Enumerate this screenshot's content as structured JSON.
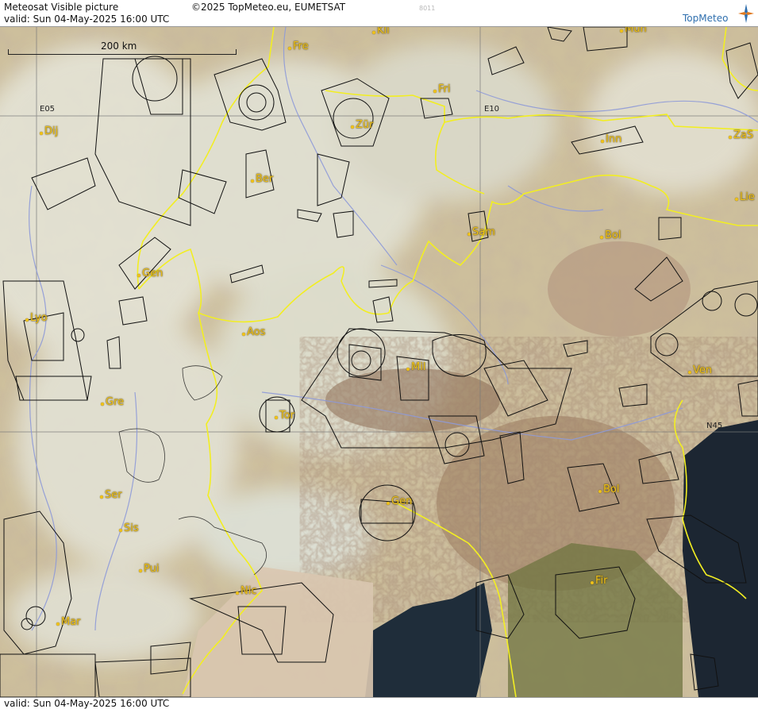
{
  "header": {
    "title": "Meteosat Visible picture",
    "copyright": "©2025 TopMeteo.eu, EUMETSAT",
    "code": "8011",
    "valid": "valid:  Sun  04-May-2025  16:00 UTC",
    "logo_text": "TopMeteo"
  },
  "footer": {
    "valid": "valid:  Sun  04-May-2025  16:00 UTC"
  },
  "scale": {
    "label": "200 km"
  },
  "grid_labels": {
    "e05": "E05",
    "e10": "E10",
    "n45": "N45"
  },
  "cities": [
    "Kli",
    "Mün",
    "Fre",
    "Fri",
    "Dij",
    "Zür",
    "Inn",
    "ZaS",
    "Ber",
    "Lie",
    "Sam",
    "Bol",
    "Gen",
    "Lyo",
    "Aos",
    "Ven",
    "Mil",
    "Gre",
    "Tor",
    "Ser",
    "Gen",
    "Bol",
    "Sis",
    "Pui",
    "Nic",
    "Fir",
    "Mar"
  ],
  "colors": {
    "land": "#cdbf9c",
    "cloud": "#e2e2d6",
    "sea": "#1d2a38",
    "border": "#f2ee22",
    "river": "#8e9ad8",
    "airspace": "#111111",
    "city": "#f0c21a",
    "logo": "#2f6fae"
  }
}
